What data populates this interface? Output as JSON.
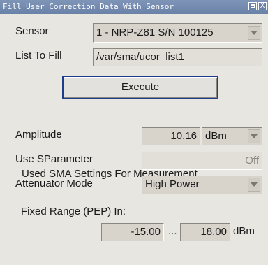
{
  "window": {
    "title": "Fill User Correction Data With Sensor",
    "title_close": "X"
  },
  "sensor": {
    "label": "Sensor",
    "value": "1 - NRP-Z81 S/N 100125"
  },
  "list": {
    "label": "List To Fill",
    "value": "/var/sma/ucor_list1"
  },
  "execute": {
    "label": "Execute"
  },
  "group": {
    "title": "Used SMA Settings For Measurement",
    "amplitude": {
      "label": "Amplitude",
      "value": "10.16",
      "unit": "dBm"
    },
    "sparam": {
      "label": "Use SParameter",
      "value": "Off"
    },
    "attenuator": {
      "label": "Attenuator Mode",
      "value": "High Power"
    },
    "range": {
      "label": "Fixed Range (PEP) In:",
      "min": "-15.00",
      "sep": "...",
      "max": "18.00",
      "unit": "dBm"
    }
  }
}
